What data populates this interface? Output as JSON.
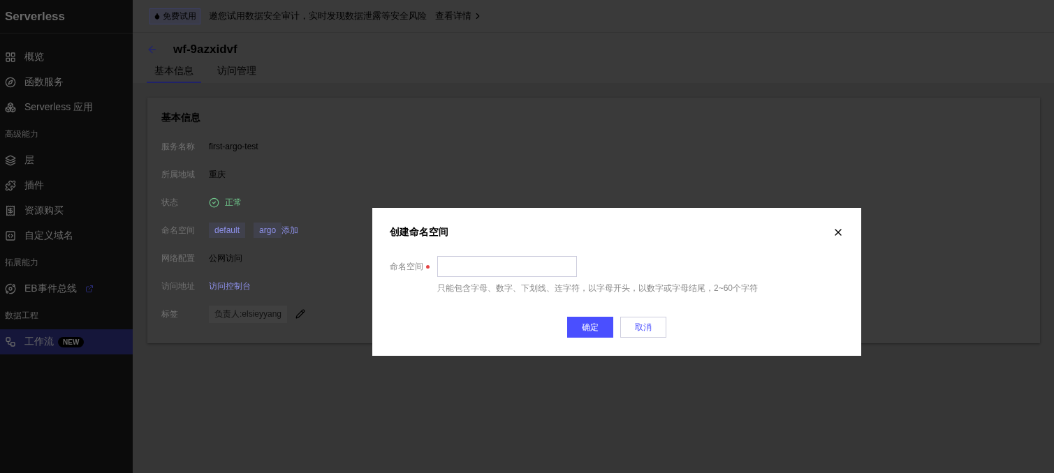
{
  "sidebar": {
    "title": "Serverless",
    "entries": [
      {
        "kind": "item",
        "label": "概览",
        "selected": false
      },
      {
        "kind": "item",
        "label": "函数服务",
        "selected": false
      },
      {
        "kind": "item",
        "label": "Serverless 应用",
        "selected": false
      },
      {
        "kind": "group",
        "label": "高级能力"
      },
      {
        "kind": "item",
        "label": "层",
        "selected": false
      },
      {
        "kind": "item",
        "label": "插件",
        "selected": false
      },
      {
        "kind": "item",
        "label": "资源购买",
        "selected": false
      },
      {
        "kind": "item",
        "label": "自定义域名",
        "selected": false
      },
      {
        "kind": "group",
        "label": "拓展能力"
      },
      {
        "kind": "item",
        "label": "EB事件总线",
        "selected": false,
        "external": true
      },
      {
        "kind": "group",
        "label": "数据工程"
      },
      {
        "kind": "item",
        "label": "工作流",
        "selected": true,
        "badge": "NEW"
      }
    ]
  },
  "banner": {
    "badge": "免费试用",
    "text": "邀您试用数据安全审计，实时发现数据泄露等安全风险",
    "link": "查看详情"
  },
  "page": {
    "title": "wf-9azxidvf",
    "tabs": [
      {
        "label": "基本信息",
        "selected": true
      },
      {
        "label": "访问管理",
        "selected": false
      }
    ]
  },
  "card": {
    "title": "基本信息",
    "rows": [
      {
        "kind": "text",
        "label": "服务名称",
        "value": "first-argo-test"
      },
      {
        "kind": "text",
        "label": "所属地域",
        "value": "重庆"
      },
      {
        "kind": "status",
        "label": "状态",
        "value": "正常"
      },
      {
        "kind": "tags",
        "label": "命名空间",
        "tags": [
          "default",
          "argo"
        ],
        "action": "添加"
      },
      {
        "kind": "text",
        "label": "网络配置",
        "value": "公网访问"
      },
      {
        "kind": "link",
        "label": "访问地址",
        "value": "访问控制台"
      },
      {
        "kind": "labels",
        "label": "标签",
        "tags": [
          "负责人:elsieyyang"
        ]
      }
    ]
  },
  "dialog": {
    "title": "创建命名空间",
    "field": {
      "label": "命名空间",
      "required": true
    },
    "hint": "只能包含字母、数字、下划线、连字符，以字母开头，以数字或字母结尾，2~60个字符",
    "buttons": [
      {
        "kind": "primary",
        "label": "确定"
      },
      {
        "kind": "default",
        "label": "取消"
      }
    ]
  }
}
